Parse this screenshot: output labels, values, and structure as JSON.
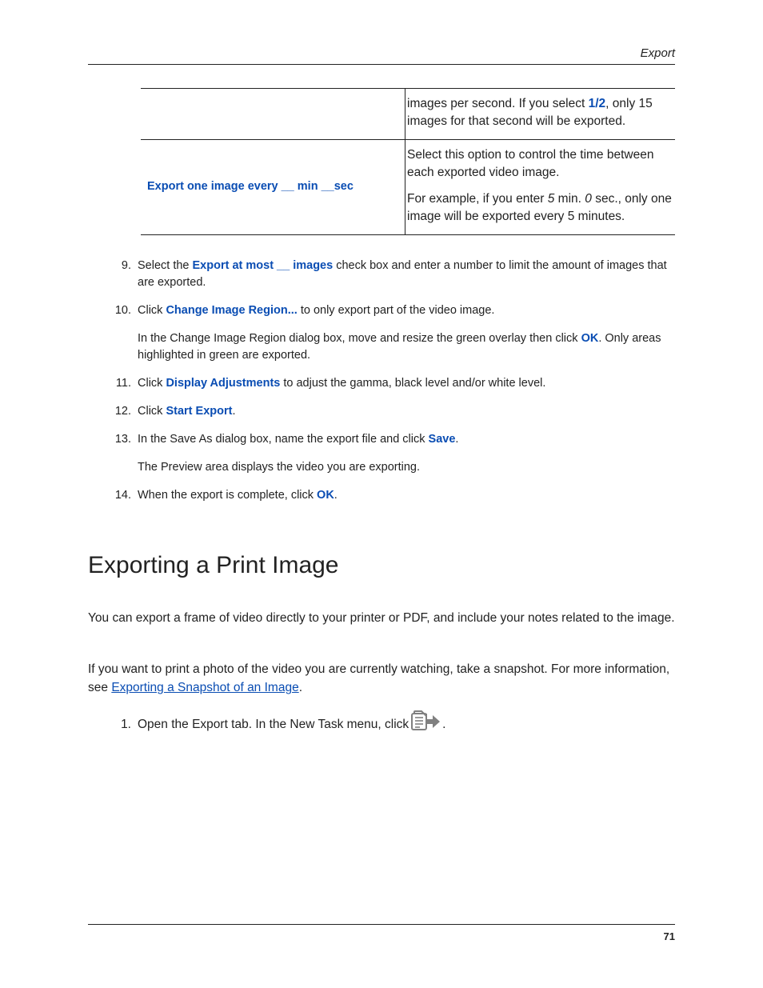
{
  "header": {
    "section": "Export"
  },
  "table": {
    "row1": {
      "left": "",
      "right_a_prefix": "images per second. If you select ",
      "right_a_bold": "1/2",
      "right_a_suffix": ", only 15 images for that second will be exported."
    },
    "row2": {
      "left": "Export one image every __ min __sec",
      "right_p1": "Select this option to control the time between each exported video image.",
      "right_p2_prefix": "For example, if you enter ",
      "right_p2_i1": "5",
      "right_p2_mid": " min. ",
      "right_p2_i2": "0",
      "right_p2_suffix": " sec., only one image will be exported every 5 minutes."
    }
  },
  "steps": {
    "s9": {
      "num": "9.",
      "t1": "Select the ",
      "b1": "Export at most __ images",
      "t2": " check box and enter a number to limit the amount of images that are exported."
    },
    "s10": {
      "num": "10.",
      "t1": "Click ",
      "b1": "Change Image Region...",
      "t2": " to only export part of the video image.",
      "sub_t1": "In the Change Image Region dialog box, move and resize the green overlay then click ",
      "sub_b1": "OK",
      "sub_t2": ". Only areas highlighted in green are exported."
    },
    "s11": {
      "num": "11.",
      "t1": "Click ",
      "b1": "Display Adjustments",
      "t2": " to adjust the gamma, black level and/or white level."
    },
    "s12": {
      "num": "12.",
      "t1": "Click ",
      "b1": "Start Export",
      "t2": "."
    },
    "s13": {
      "num": "13.",
      "t1": "In the Save As dialog box, name the export file and click ",
      "b1": "Save",
      "t2": ".",
      "sub": "The Preview area displays the video you are exporting."
    },
    "s14": {
      "num": "14.",
      "t1": "When the export is complete, click ",
      "b1": "OK",
      "t2": "."
    }
  },
  "heading": "Exporting a Print Image",
  "para1": "You can export a frame of video directly to your printer or PDF, and include your notes related to the image.",
  "para2_t1": "If you want to print a photo of the video you are currently watching, take a snapshot. For more information, see ",
  "para2_link": "Exporting a Snapshot of an Image",
  "para2_t2": ".",
  "steps2": {
    "s1": {
      "num": "1.",
      "t1": "Open the Export tab. In the New Task menu, click ",
      "t2": "."
    }
  },
  "page_number": "71"
}
